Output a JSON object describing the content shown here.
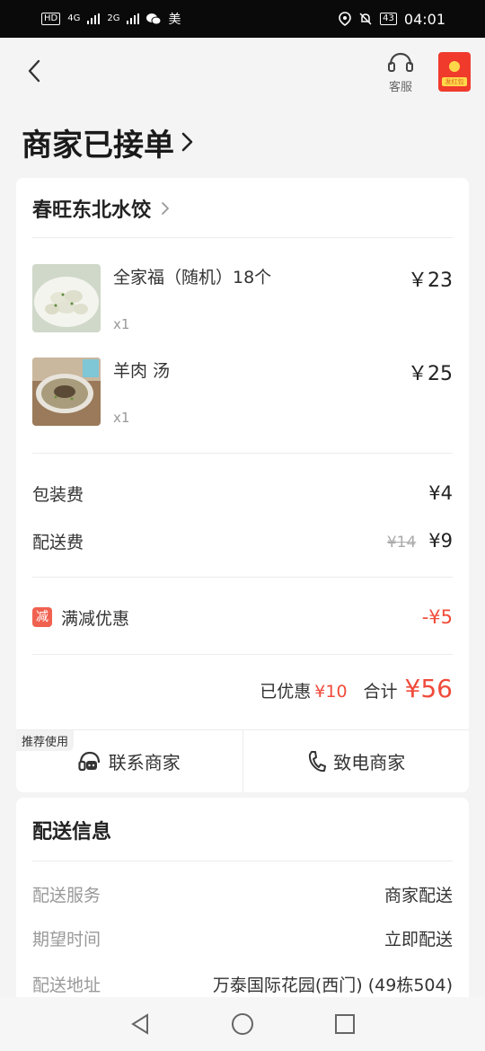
{
  "status_bar": {
    "network_left": "HD",
    "signal1": "4G",
    "signal2": "2G",
    "app_label": "美",
    "battery": "43",
    "time": "04:01"
  },
  "header": {
    "customer_service_label": "客服",
    "red_packet_label": "发红包"
  },
  "page_title": "商家已接单",
  "order": {
    "shop_name": "春旺东北水饺",
    "items": [
      {
        "name": "全家福（随机）18个",
        "qty": "x1",
        "price": "￥23"
      },
      {
        "name": "羊肉 汤",
        "qty": "x1",
        "price": "￥25"
      }
    ],
    "packing_fee_label": "包装费",
    "packing_fee": "¥4",
    "delivery_fee_label": "配送费",
    "delivery_fee_original": "¥14",
    "delivery_fee": "¥9",
    "discount_badge": "减",
    "discount_label": "满减优惠",
    "discount_value": "-¥5",
    "saved_label": "已优惠",
    "saved_value": "¥10",
    "total_label": "合计",
    "total_value": "¥56",
    "recommend_tag": "推荐使用",
    "contact_merchant": "联系商家",
    "call_merchant": "致电商家"
  },
  "delivery": {
    "title": "配送信息",
    "rows": [
      {
        "label": "配送服务",
        "value": "商家配送"
      },
      {
        "label": "期望时间",
        "value": "立即配送"
      },
      {
        "label": "配送地址",
        "value": "万泰国际花园(西门) (49栋504)"
      }
    ]
  },
  "colors": {
    "accent_red": "#f04b3b",
    "background": "#f4f4f4"
  }
}
